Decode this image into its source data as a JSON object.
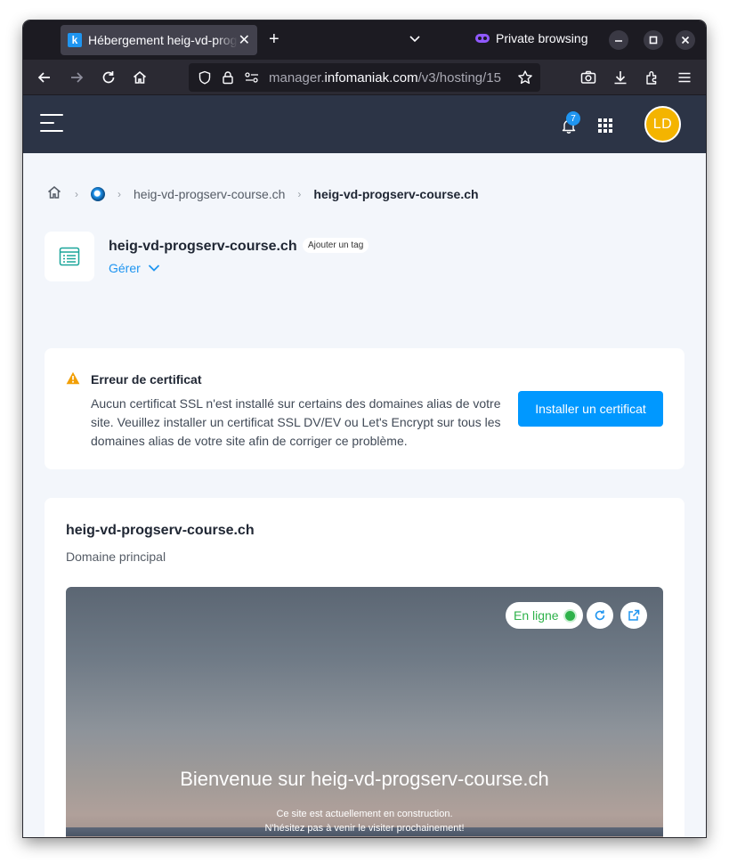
{
  "browser": {
    "tab_title": "Hébergement heig-vd-progserv-course.ch",
    "private_label": "Private browsing",
    "url_prefix": "manager.",
    "url_domain": "infomaniak.com",
    "url_path": "/v3/hosting/15"
  },
  "header": {
    "notification_count": "7",
    "avatar_initials": "LD"
  },
  "breadcrumb": {
    "items": [
      "heig-vd-progserv-course.ch",
      "heig-vd-progserv-course.ch"
    ]
  },
  "site": {
    "name": "heig-vd-progserv-course.ch",
    "tag_button": "Ajouter un tag",
    "manage_label": "Gérer"
  },
  "alert": {
    "title": "Erreur de certificat",
    "message": "Aucun certificat SSL n'est installé sur certains des domaines alias de votre site. Veuillez installer un certificat SSL DV/EV ou Let's Encrypt sur tous les domaines alias de votre site afin de corriger ce problème.",
    "button": "Installer un certificat",
    "color": "#f29f05"
  },
  "domain": {
    "name": "heig-vd-progserv-course.ch",
    "subtitle": "Domaine principal",
    "status": "En ligne",
    "status_color": "#2eb24a",
    "preview_title": "Bienvenue sur heig-vd-progserv-course.ch",
    "preview_line1": "Ce site est actuellement en construction.",
    "preview_line2": "N'hésitez pas à venir le visiter prochainement!"
  }
}
